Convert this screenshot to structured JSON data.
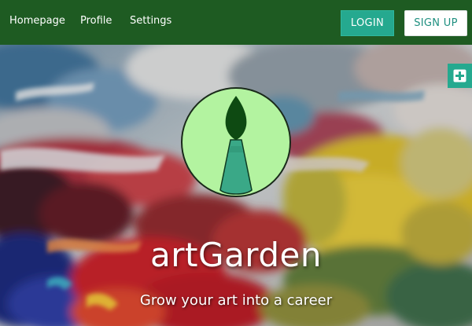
{
  "nav": {
    "links": [
      "Homepage",
      "Profile",
      "Settings"
    ],
    "login_label": "LOGIN",
    "signup_label": "SIGN UP"
  },
  "hero": {
    "brand": "artGarden",
    "tagline": "Grow your art into a career"
  },
  "colors": {
    "navbar": "#1e5b22",
    "accent": "#25a98f",
    "logo_bg": "#b3f3a0",
    "brush_tip": "#0e4a12"
  },
  "icons": {
    "side_button": "plus-square-icon",
    "logo": "paintbrush-icon"
  }
}
